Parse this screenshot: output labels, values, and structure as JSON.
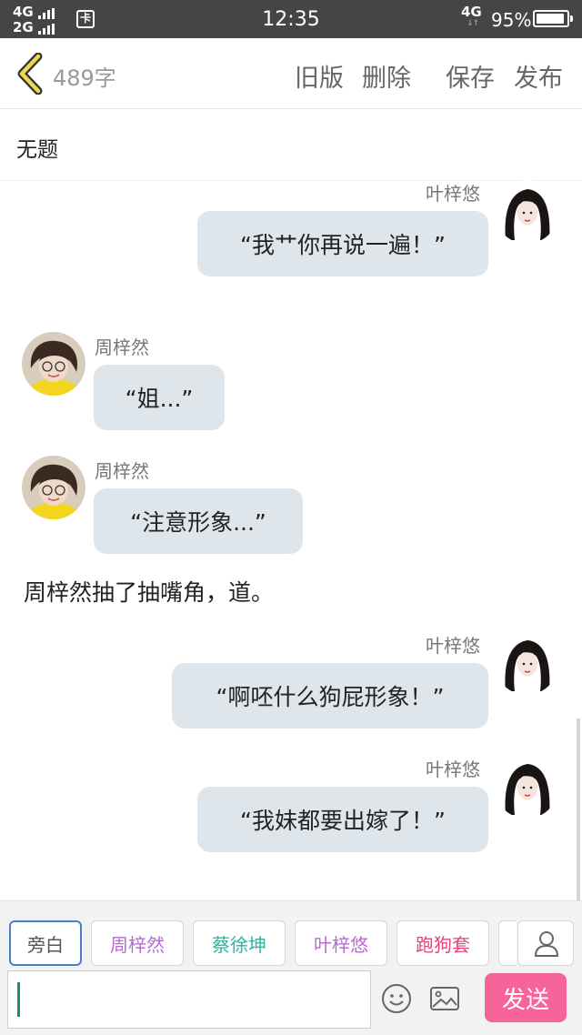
{
  "status_bar": {
    "signal_1": "4G",
    "signal_2": "2G",
    "time": "12:35",
    "network": "4G",
    "battery": "95%"
  },
  "header": {
    "word_count": "489字",
    "old_version": "旧版",
    "delete": "删除",
    "save": "保存",
    "publish": "发布"
  },
  "doc_title": "无题",
  "messages": [
    {
      "speaker": "叶梓悠",
      "text": "“我艹你再说一遍！”"
    },
    {
      "speaker": "周梓然",
      "text": "“姐...”"
    },
    {
      "speaker": "周梓然",
      "text": "“注意形象...”"
    },
    {
      "speaker": "叶梓悠",
      "text": "“啊呸什么狗屁形象！”"
    },
    {
      "speaker": "叶梓悠",
      "text": "“我妹都要出嫁了！”"
    }
  ],
  "narration": "周梓然抽了抽嘴角，道。",
  "role_tags": [
    {
      "label": "旁白",
      "color": "#555555"
    },
    {
      "label": "周梓然",
      "color": "#b56cd0"
    },
    {
      "label": "蔡徐坤",
      "color": "#2fb3a0"
    },
    {
      "label": "叶梓悠",
      "color": "#b56cd0"
    },
    {
      "label": "跑狗套",
      "color": "#e0457b"
    }
  ],
  "input": {
    "value": ""
  },
  "send_label": "发送",
  "colors": {
    "accent": "#f7649a",
    "bubble": "#dfe6eb"
  }
}
